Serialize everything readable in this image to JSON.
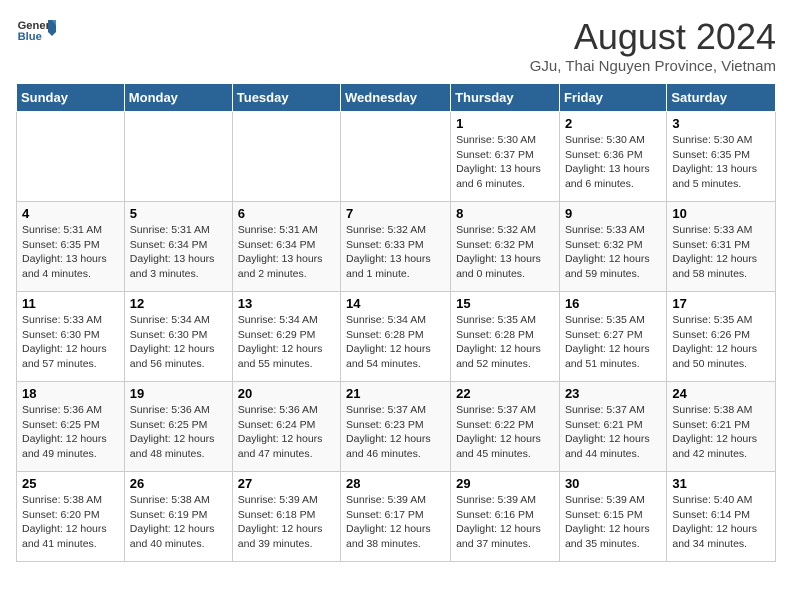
{
  "header": {
    "logo_general": "General",
    "logo_blue": "Blue",
    "month_year": "August 2024",
    "location": "GJu, Thai Nguyen Province, Vietnam"
  },
  "weekdays": [
    "Sunday",
    "Monday",
    "Tuesday",
    "Wednesday",
    "Thursday",
    "Friday",
    "Saturday"
  ],
  "weeks": [
    [
      {
        "day": "",
        "info": ""
      },
      {
        "day": "",
        "info": ""
      },
      {
        "day": "",
        "info": ""
      },
      {
        "day": "",
        "info": ""
      },
      {
        "day": "1",
        "info": "Sunrise: 5:30 AM\nSunset: 6:37 PM\nDaylight: 13 hours\nand 6 minutes."
      },
      {
        "day": "2",
        "info": "Sunrise: 5:30 AM\nSunset: 6:36 PM\nDaylight: 13 hours\nand 6 minutes."
      },
      {
        "day": "3",
        "info": "Sunrise: 5:30 AM\nSunset: 6:35 PM\nDaylight: 13 hours\nand 5 minutes."
      }
    ],
    [
      {
        "day": "4",
        "info": "Sunrise: 5:31 AM\nSunset: 6:35 PM\nDaylight: 13 hours\nand 4 minutes."
      },
      {
        "day": "5",
        "info": "Sunrise: 5:31 AM\nSunset: 6:34 PM\nDaylight: 13 hours\nand 3 minutes."
      },
      {
        "day": "6",
        "info": "Sunrise: 5:31 AM\nSunset: 6:34 PM\nDaylight: 13 hours\nand 2 minutes."
      },
      {
        "day": "7",
        "info": "Sunrise: 5:32 AM\nSunset: 6:33 PM\nDaylight: 13 hours\nand 1 minute."
      },
      {
        "day": "8",
        "info": "Sunrise: 5:32 AM\nSunset: 6:32 PM\nDaylight: 13 hours\nand 0 minutes."
      },
      {
        "day": "9",
        "info": "Sunrise: 5:33 AM\nSunset: 6:32 PM\nDaylight: 12 hours\nand 59 minutes."
      },
      {
        "day": "10",
        "info": "Sunrise: 5:33 AM\nSunset: 6:31 PM\nDaylight: 12 hours\nand 58 minutes."
      }
    ],
    [
      {
        "day": "11",
        "info": "Sunrise: 5:33 AM\nSunset: 6:30 PM\nDaylight: 12 hours\nand 57 minutes."
      },
      {
        "day": "12",
        "info": "Sunrise: 5:34 AM\nSunset: 6:30 PM\nDaylight: 12 hours\nand 56 minutes."
      },
      {
        "day": "13",
        "info": "Sunrise: 5:34 AM\nSunset: 6:29 PM\nDaylight: 12 hours\nand 55 minutes."
      },
      {
        "day": "14",
        "info": "Sunrise: 5:34 AM\nSunset: 6:28 PM\nDaylight: 12 hours\nand 54 minutes."
      },
      {
        "day": "15",
        "info": "Sunrise: 5:35 AM\nSunset: 6:28 PM\nDaylight: 12 hours\nand 52 minutes."
      },
      {
        "day": "16",
        "info": "Sunrise: 5:35 AM\nSunset: 6:27 PM\nDaylight: 12 hours\nand 51 minutes."
      },
      {
        "day": "17",
        "info": "Sunrise: 5:35 AM\nSunset: 6:26 PM\nDaylight: 12 hours\nand 50 minutes."
      }
    ],
    [
      {
        "day": "18",
        "info": "Sunrise: 5:36 AM\nSunset: 6:25 PM\nDaylight: 12 hours\nand 49 minutes."
      },
      {
        "day": "19",
        "info": "Sunrise: 5:36 AM\nSunset: 6:25 PM\nDaylight: 12 hours\nand 48 minutes."
      },
      {
        "day": "20",
        "info": "Sunrise: 5:36 AM\nSunset: 6:24 PM\nDaylight: 12 hours\nand 47 minutes."
      },
      {
        "day": "21",
        "info": "Sunrise: 5:37 AM\nSunset: 6:23 PM\nDaylight: 12 hours\nand 46 minutes."
      },
      {
        "day": "22",
        "info": "Sunrise: 5:37 AM\nSunset: 6:22 PM\nDaylight: 12 hours\nand 45 minutes."
      },
      {
        "day": "23",
        "info": "Sunrise: 5:37 AM\nSunset: 6:21 PM\nDaylight: 12 hours\nand 44 minutes."
      },
      {
        "day": "24",
        "info": "Sunrise: 5:38 AM\nSunset: 6:21 PM\nDaylight: 12 hours\nand 42 minutes."
      }
    ],
    [
      {
        "day": "25",
        "info": "Sunrise: 5:38 AM\nSunset: 6:20 PM\nDaylight: 12 hours\nand 41 minutes."
      },
      {
        "day": "26",
        "info": "Sunrise: 5:38 AM\nSunset: 6:19 PM\nDaylight: 12 hours\nand 40 minutes."
      },
      {
        "day": "27",
        "info": "Sunrise: 5:39 AM\nSunset: 6:18 PM\nDaylight: 12 hours\nand 39 minutes."
      },
      {
        "day": "28",
        "info": "Sunrise: 5:39 AM\nSunset: 6:17 PM\nDaylight: 12 hours\nand 38 minutes."
      },
      {
        "day": "29",
        "info": "Sunrise: 5:39 AM\nSunset: 6:16 PM\nDaylight: 12 hours\nand 37 minutes."
      },
      {
        "day": "30",
        "info": "Sunrise: 5:39 AM\nSunset: 6:15 PM\nDaylight: 12 hours\nand 35 minutes."
      },
      {
        "day": "31",
        "info": "Sunrise: 5:40 AM\nSunset: 6:14 PM\nDaylight: 12 hours\nand 34 minutes."
      }
    ]
  ]
}
